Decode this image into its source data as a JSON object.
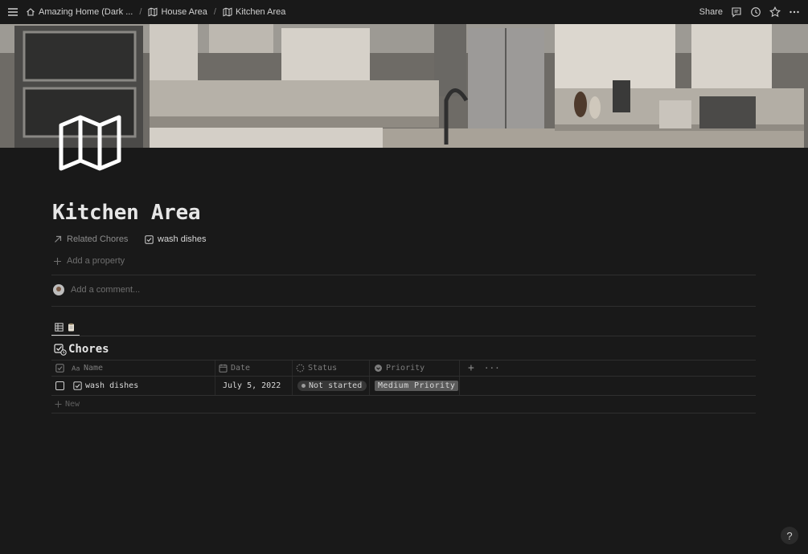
{
  "breadcrumbs": [
    {
      "label": "Amazing Home (Dark ...",
      "icon": "home-icon"
    },
    {
      "label": "House Area",
      "icon": "map-icon"
    },
    {
      "label": "Kitchen Area",
      "icon": "map-icon"
    }
  ],
  "breadcrumb_separator": "/",
  "topbar": {
    "share_label": "Share",
    "icons": [
      "comment-icon",
      "history-icon",
      "star-icon",
      "more-icon"
    ]
  },
  "cover": {
    "subject": "kitchen photo",
    "icon": "map-icon"
  },
  "page": {
    "title": "Kitchen Area",
    "property_label": "Related Chores",
    "property_value": "wash dishes",
    "add_property": "Add a property",
    "comment_placeholder": "Add a comment..."
  },
  "database": {
    "view_icon": "table-icon",
    "title": "Chores",
    "columns": [
      "Name",
      "Date",
      "Status",
      "Priority"
    ],
    "rows": [
      {
        "name": "wash dishes",
        "date": "July 5, 2022",
        "status": "Not started",
        "priority": "Medium Priority",
        "checked": false
      }
    ],
    "new_label": "New",
    "add_column": "+",
    "more": "···"
  },
  "help_label": "?",
  "colors": {
    "background": "#191919",
    "priority_pill": "#5a5a5a",
    "status_pill": "#373737"
  }
}
